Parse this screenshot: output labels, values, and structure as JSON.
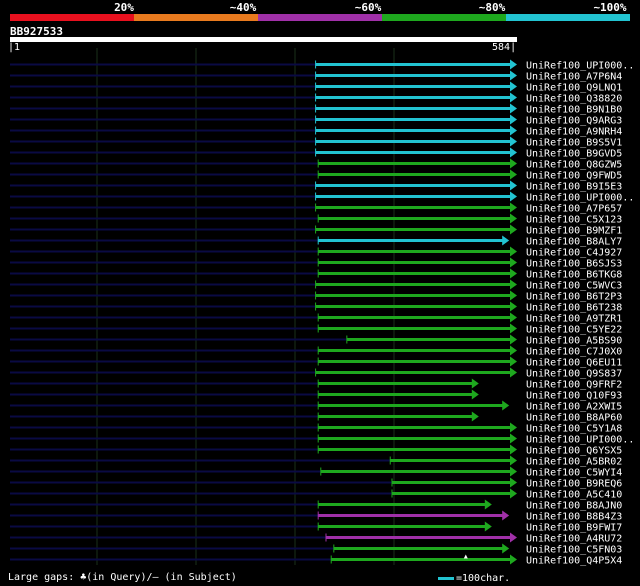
{
  "legend": {
    "labels": [
      "20%",
      "~40%",
      "~60%",
      "~80%",
      "~100%"
    ],
    "colors": [
      "#e8101e",
      "#e87a1e",
      "#a030a8",
      "#1ea81e",
      "#22c3d1"
    ]
  },
  "query": {
    "name": "BB927533",
    "start": "1",
    "end": "584",
    "length": 584
  },
  "colors": {
    "cyan": "#22c3d1",
    "green": "#1ea81e",
    "magenta": "#a030a8",
    "query_backbone": "#0a0a44",
    "grid": "#1a301a",
    "label": "#ffffff"
  },
  "hits": [
    {
      "label": "UniRef100_UPI000..",
      "start": 352,
      "end": 601,
      "color": "cyan"
    },
    {
      "label": "UniRef100_A7P6N4",
      "start": 352,
      "end": 601,
      "color": "cyan"
    },
    {
      "label": "UniRef100_Q9LNQ1",
      "start": 352,
      "end": 601,
      "color": "cyan"
    },
    {
      "label": "UniRef100_Q38820",
      "start": 352,
      "end": 601,
      "color": "cyan"
    },
    {
      "label": "UniRef100_B9N1B0",
      "start": 352,
      "end": 601,
      "color": "cyan"
    },
    {
      "label": "UniRef100_Q9ARG3",
      "start": 352,
      "end": 601,
      "color": "cyan"
    },
    {
      "label": "UniRef100_A9NRH4",
      "start": 352,
      "end": 601,
      "color": "cyan"
    },
    {
      "label": "UniRef100_B9S5V1",
      "start": 352,
      "end": 601,
      "color": "cyan"
    },
    {
      "label": "UniRef100_B9GVD5",
      "start": 352,
      "end": 601,
      "color": "cyan"
    },
    {
      "label": "UniRef100_Q8GZW5",
      "start": 355,
      "end": 595,
      "color": "green"
    },
    {
      "label": "UniRef100_Q9FWD5",
      "start": 355,
      "end": 595,
      "color": "green"
    },
    {
      "label": "UniRef100_B9I5E3",
      "start": 352,
      "end": 601,
      "color": "cyan"
    },
    {
      "label": "UniRef100_UPI000..",
      "start": 352,
      "end": 601,
      "color": "cyan"
    },
    {
      "label": "UniRef100_A7P657",
      "start": 352,
      "end": 601,
      "color": "green"
    },
    {
      "label": "UniRef100_C5X123",
      "start": 355,
      "end": 595,
      "color": "green"
    },
    {
      "label": "UniRef100_B9MZF1",
      "start": 352,
      "end": 601,
      "color": "green"
    },
    {
      "label": "UniRef100_B8ALY7",
      "start": 355,
      "end": 575,
      "color": "cyan"
    },
    {
      "label": "UniRef100_C4J927",
      "start": 355,
      "end": 595,
      "color": "green"
    },
    {
      "label": "UniRef100_B6SJS3",
      "start": 355,
      "end": 595,
      "color": "green"
    },
    {
      "label": "UniRef100_B6TKG8",
      "start": 355,
      "end": 595,
      "color": "green"
    },
    {
      "label": "UniRef100_C5WVC3",
      "start": 352,
      "end": 601,
      "color": "green"
    },
    {
      "label": "UniRef100_B6T2P3",
      "start": 352,
      "end": 601,
      "color": "green"
    },
    {
      "label": "UniRef100_B6T238",
      "start": 352,
      "end": 601,
      "color": "green"
    },
    {
      "label": "UniRef100_A9TZR1",
      "start": 355,
      "end": 601,
      "color": "green"
    },
    {
      "label": "UniRef100_C5YE22",
      "start": 355,
      "end": 595,
      "color": "green"
    },
    {
      "label": "UniRef100_A5BS90",
      "start": 388,
      "end": 601,
      "color": "green"
    },
    {
      "label": "UniRef100_C7J0X0",
      "start": 355,
      "end": 595,
      "color": "green"
    },
    {
      "label": "UniRef100_Q6EU11",
      "start": 355,
      "end": 595,
      "color": "green"
    },
    {
      "label": "UniRef100_Q9S837",
      "start": 352,
      "end": 601,
      "color": "green"
    },
    {
      "label": "UniRef100_Q9FRF2",
      "start": 355,
      "end": 540,
      "color": "green"
    },
    {
      "label": "UniRef100_Q10F93",
      "start": 355,
      "end": 540,
      "color": "green"
    },
    {
      "label": "UniRef100_A2XWI5",
      "start": 355,
      "end": 575,
      "color": "green"
    },
    {
      "label": "UniRef100_B8AP60",
      "start": 355,
      "end": 540,
      "color": "green"
    },
    {
      "label": "UniRef100_C5Y1A8",
      "start": 355,
      "end": 595,
      "color": "green"
    },
    {
      "label": "UniRef100_UPI000..",
      "start": 355,
      "end": 595,
      "color": "green"
    },
    {
      "label": "UniRef100_Q6YSX5",
      "start": 355,
      "end": 595,
      "color": "green"
    },
    {
      "label": "UniRef100_A5BR02",
      "start": 438,
      "end": 601,
      "color": "green"
    },
    {
      "label": "UniRef100_C5WYI4",
      "start": 358,
      "end": 595,
      "color": "green"
    },
    {
      "label": "UniRef100_B9REQ6",
      "start": 440,
      "end": 601,
      "color": "green"
    },
    {
      "label": "UniRef100_A5C410",
      "start": 440,
      "end": 601,
      "color": "green"
    },
    {
      "label": "UniRef100_B8AJN0",
      "start": 355,
      "end": 555,
      "color": "green"
    },
    {
      "label": "UniRef100_B8B4Z3",
      "start": 355,
      "end": 575,
      "color": "magenta"
    },
    {
      "label": "UniRef100_B9FWI7",
      "start": 355,
      "end": 555,
      "color": "green"
    },
    {
      "label": "UniRef100_A4RU72",
      "start": 364,
      "end": 601,
      "color": "magenta"
    },
    {
      "label": "UniRef100_C5FN03",
      "start": 373,
      "end": 575,
      "color": "green"
    },
    {
      "label": "UniRef100_Q4P5X4",
      "start": 370,
      "end": 590,
      "color": "green"
    }
  ],
  "gap_markers": [
    {
      "row": 45,
      "pos": 525
    }
  ],
  "footer": {
    "text": "Large gaps: ♣(in Query)/– (in Subject)",
    "scale_label": "=100char."
  }
}
